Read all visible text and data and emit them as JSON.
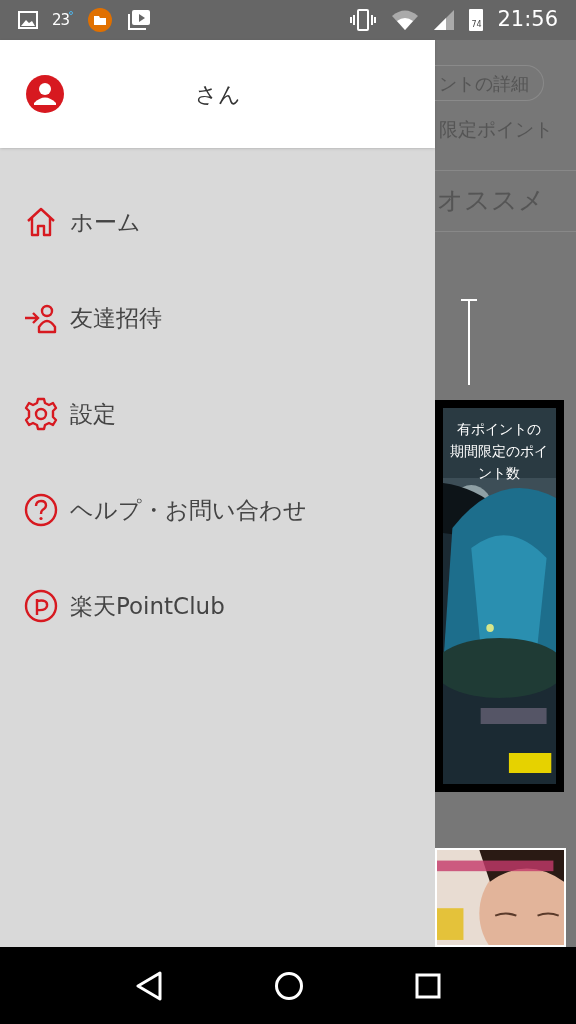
{
  "status_bar": {
    "temperature": "23",
    "battery": "74",
    "time": "21:56"
  },
  "drawer": {
    "user_name": "さん",
    "items": [
      {
        "kind": "home",
        "label": "ホーム"
      },
      {
        "kind": "invite",
        "label": "友達招待"
      },
      {
        "kind": "settings",
        "label": "設定"
      },
      {
        "kind": "help",
        "label": "ヘルプ・お問い合わせ"
      },
      {
        "kind": "point",
        "label": "楽天PointClub"
      }
    ]
  },
  "background": {
    "detail_button": "ントの詳細",
    "points_label": "限定ポイント",
    "tab": "オススメ",
    "tooltip_lines": [
      "有ポイントの",
      "期間限定のポイ",
      "ント数"
    ]
  }
}
